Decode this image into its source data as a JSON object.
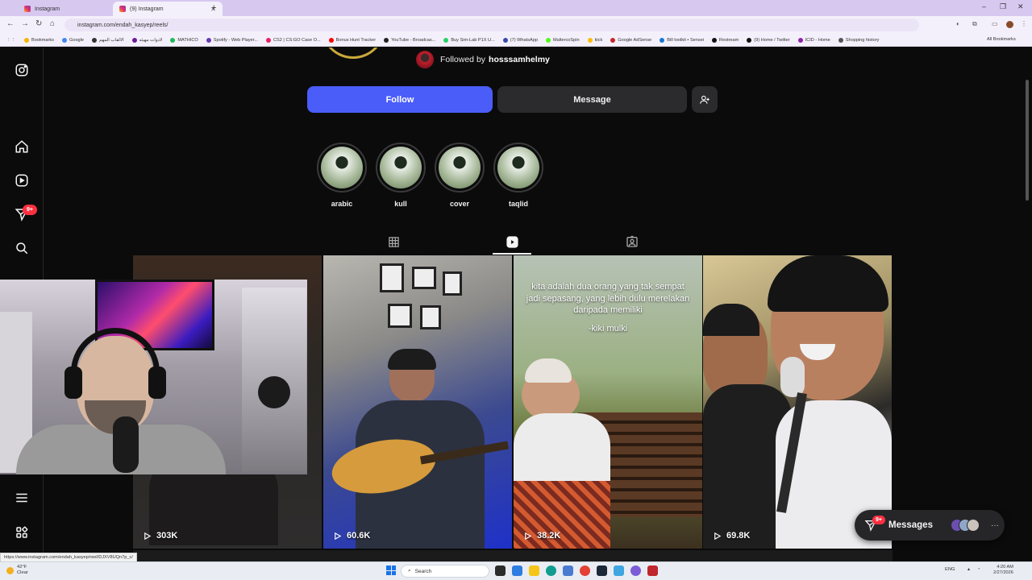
{
  "browser": {
    "tabs": [
      {
        "title": "Instagram"
      },
      {
        "title": "(9) Instagram"
      }
    ],
    "new_tab": "+",
    "url": "instagram.com/endah_kasyep/reels/",
    "window_controls": {
      "minimize": "–",
      "restore": "❐",
      "close": "✕"
    },
    "bookmarks": [
      "Bookmarks",
      "Google",
      "الالقاب المهم",
      "لادوات مهيئه",
      "MATHICO",
      "Spotify - Web Player...",
      "CS2 | CS:GO Case O...",
      "Bonus Hunt Tracker",
      "YouTube - Broadcas...",
      "Buy Sim-Lab P1X U...",
      "(7) WhatsApp",
      "MaltercoSpin",
      "kick",
      "Google AdSense",
      "Bill toolkit • Sensei",
      "Restream",
      "(9) Home / Twitter",
      "ICID - Home",
      "Shopping history"
    ],
    "all_bookmarks": "All Bookmarks",
    "status_url": "https://www.instagram.com/endah_kasyep/reel/DJXV8UQn7p_c/"
  },
  "profile": {
    "followed_by_prefix": "Followed by",
    "followed_by_user": "hosssamhelmy",
    "follow_label": "Follow",
    "message_label": "Message"
  },
  "highlights": [
    {
      "label": "arabic"
    },
    {
      "label": "kull"
    },
    {
      "label": "cover"
    },
    {
      "label": "taqlid"
    }
  ],
  "sidebar": {
    "notification_badge": "9+"
  },
  "reels": [
    {
      "views": "303K"
    },
    {
      "views": "60.6K"
    },
    {
      "views": "38.2K",
      "caption": "kita adalah dua orang yang tak sempat jadi sepasang, yang lebih dulu merelakan daripada memiliki",
      "signature": "-kiki mulki"
    },
    {
      "views": "69.8K"
    }
  ],
  "messages": {
    "label": "Messages",
    "badge": "9+",
    "more": "···"
  },
  "taskbar": {
    "weather_temp": "42°F",
    "weather_desc": "Clear",
    "search_placeholder": "Search",
    "lang": "ENG",
    "time": "4:20 AM",
    "date": "2/27/2026"
  },
  "colors": {
    "follow_button": "#4a5df9",
    "badge_red": "#ff3040",
    "page_bg": "#0b0b0c"
  }
}
